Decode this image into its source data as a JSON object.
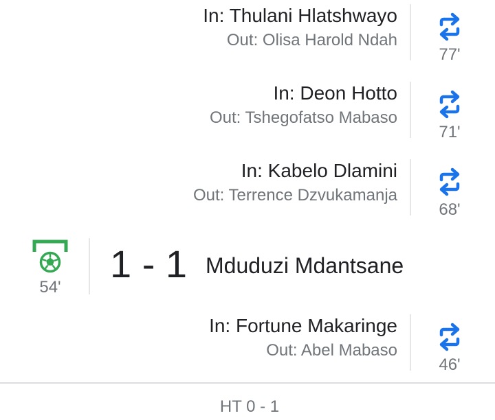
{
  "colors": {
    "primary_text": "#202124",
    "secondary_text": "#70757a",
    "substitution_icon": "#1a73e8",
    "goal_icon": "#34a853",
    "divider": "#dadce0"
  },
  "icons": {
    "substitution": "swap-arrows-icon",
    "goal": "soccer-ball-goal-icon"
  },
  "substitutions_top": [
    {
      "in": "In: Thulani Hlatshwayo",
      "out": "Out: Olisa Harold Ndah",
      "minute": "77'"
    },
    {
      "in": "In: Deon Hotto",
      "out": "Out: Tshegofatso Mabaso",
      "minute": "71'"
    },
    {
      "in": "In: Kabelo Dlamini",
      "out": "Out: Terrence Dzvukamanja",
      "minute": "68'"
    }
  ],
  "goal": {
    "minute": "54'",
    "score": "1 - 1",
    "scorer": "Mduduzi Mdantsane"
  },
  "substitutions_bottom": [
    {
      "in": "In: Fortune Makaringe",
      "out": "Out: Abel Mabaso",
      "minute": "46'"
    }
  ],
  "halftime": "HT 0 - 1"
}
